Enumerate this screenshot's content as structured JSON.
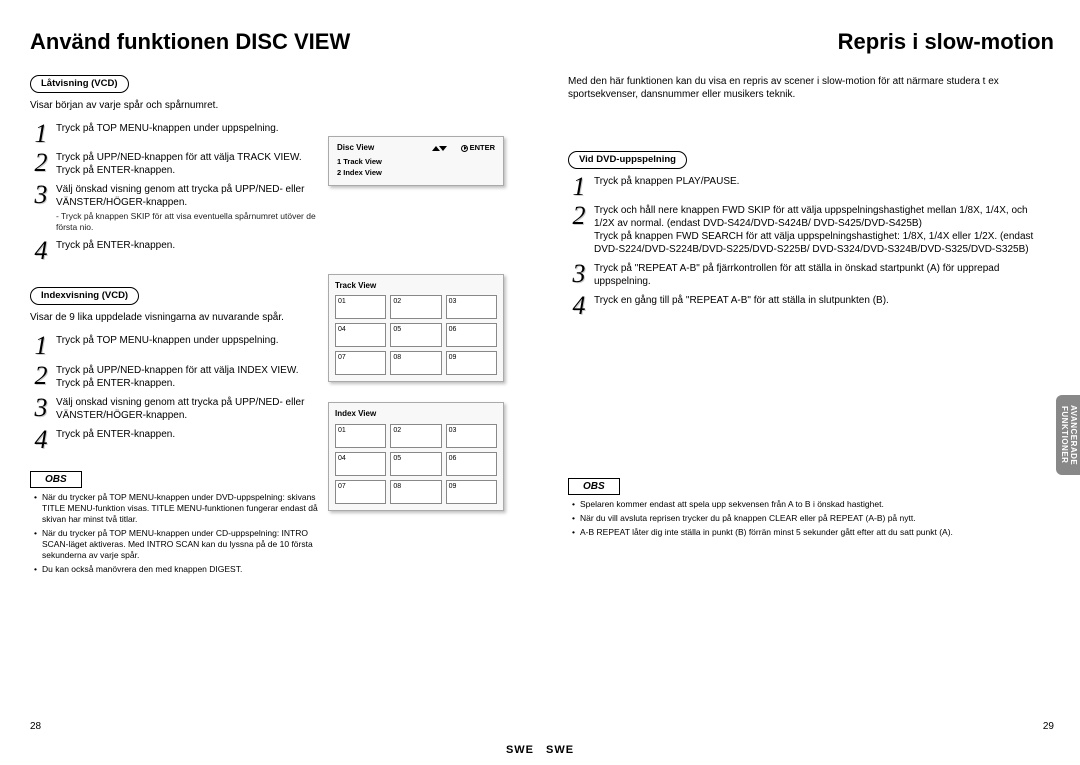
{
  "left": {
    "title": "Använd funktionen DISC VIEW",
    "section1": {
      "heading": "Låtvisning (VCD)",
      "intro": "Visar början av varje spår och spårnumret.",
      "steps": [
        {
          "num": "1",
          "text": "Tryck på TOP MENU-knappen under uppspelning."
        },
        {
          "num": "2",
          "text": "Tryck på UPP/NED-knappen för att välja TRACK VIEW.\nTryck på ENTER-knappen."
        },
        {
          "num": "3",
          "text": "Välj önskad visning genom att trycka på UPP/NED- eller VÄNSTER/HÖGER-knappen.",
          "sub": "- Tryck på knappen SKIP för att visa eventuella spårnumret utöver de första nio."
        },
        {
          "num": "4",
          "text": "Tryck på ENTER-knappen."
        }
      ]
    },
    "section2": {
      "heading": "Indexvisning (VCD)",
      "intro": "Visar de 9 lika uppdelade visningarna av nuvarande spår.",
      "steps": [
        {
          "num": "1",
          "text": "Tryck på TOP MENU-knappen under uppspelning."
        },
        {
          "num": "2",
          "text": "Tryck på UPP/NED-knappen för att välja INDEX VIEW. Tryck på ENTER-knappen."
        },
        {
          "num": "3",
          "text": "Välj onskad visning genom att trycka på UPP/NED- eller VÄNSTER/HÖGER-knappen."
        },
        {
          "num": "4",
          "text": "Tryck på ENTER-knappen."
        }
      ]
    },
    "obs_label": "OBS",
    "notes": [
      "När du trycker på TOP MENU-knappen under DVD-uppspelning: skivans TITLE MENU-funktion visas. TITLE MENU-funktionen fungerar endast då skivan har minst två titlar.",
      "När du trycker på TOP MENU-knappen under CD-uppspelning: INTRO SCAN-läget aktiveras. Med INTRO SCAN kan du lyssna på de 10 första sekunderna av varje spår.",
      "Du kan också manövrera den med knappen DIGEST."
    ],
    "page_number": "28",
    "footer": "SWE",
    "osd": {
      "title": "Disc View",
      "nav_label": "",
      "enter_label": "ENTER",
      "items": [
        "1  Track  View",
        "2  Index  View"
      ]
    },
    "panel_track": {
      "title": "Track View",
      "cells": [
        "01",
        "02",
        "03",
        "04",
        "05",
        "06",
        "07",
        "08",
        "09"
      ]
    },
    "panel_index": {
      "title": "Index View",
      "cells": [
        "01",
        "02",
        "03",
        "04",
        "05",
        "06",
        "07",
        "08",
        "09"
      ]
    }
  },
  "right": {
    "title": "Repris i slow-motion",
    "intro": "Med den här funktionen kan du visa en repris av scener i slow-motion för att närmare studera t ex sportsekvenser, dansnummer eller musikers teknik.",
    "section": {
      "heading": "Vid DVD-uppspelning",
      "steps": [
        {
          "num": "1",
          "text": "Tryck på knappen PLAY/PAUSE."
        },
        {
          "num": "2",
          "text": "Tryck och håll nere knappen FWD SKIP för att välja uppspelningshastighet mellan 1/8X, 1/4X, och 1/2X av normal. (endast DVD-S424/DVD-S424B/ DVD-S425/DVD-S425B)\nTryck på knappen FWD SEARCH för att välja uppspelningshastighet: 1/8X, 1/4X eller 1/2X. (endast DVD-S224/DVD-S224B/DVD-S225/DVD-S225B/ DVD-S324/DVD-S324B/DVD-S325/DVD-S325B)"
        },
        {
          "num": "3",
          "text": "Tryck på \"REPEAT A-B\" på fjärrkontrollen för att ställa in önskad startpunkt (A) för upprepad uppspelning."
        },
        {
          "num": "4",
          "text": "Tryck en gång till på \"REPEAT A-B\" för att ställa in slutpunkten (B)."
        }
      ]
    },
    "obs_label": "OBS",
    "notes": [
      "Spelaren kommer endast att spela upp sekvensen från A to B i önskad hastighet.",
      "När du vill avsluta reprisen trycker du på knappen CLEAR eller på REPEAT (A-B) på nytt.",
      "A-B REPEAT låter dig inte ställa in punkt (B) förrän minst 5 sekunder gått efter att du satt punkt (A)."
    ],
    "page_number": "29",
    "footer": "SWE",
    "side_tab": "AVANCERADE\nFUNKTIONER"
  }
}
